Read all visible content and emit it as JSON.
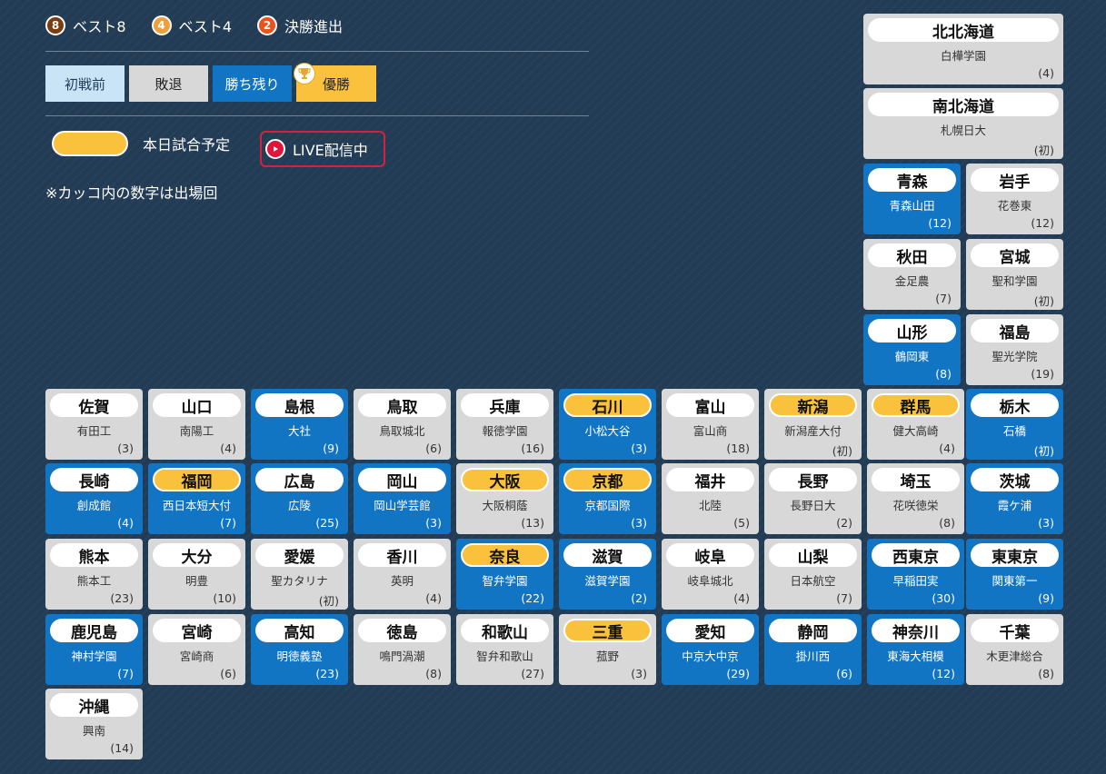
{
  "legend": [
    {
      "num": "8",
      "label": "ベスト8",
      "color": "#7a3d10"
    },
    {
      "num": "4",
      "label": "ベスト4",
      "color": "#ef9f3a"
    },
    {
      "num": "2",
      "label": "決勝進出",
      "color": "#e8541b"
    }
  ],
  "status": {
    "before": "初戦前",
    "lost": "敗退",
    "remaining": "勝ち残り",
    "champion": "優勝"
  },
  "today_label": "本日試合予定",
  "live_label": "LIVE配信中",
  "note": "※カッコ内の数字は出場回",
  "colors": {
    "remaining": "#1275c4",
    "lost": "#d8d8d8",
    "before": "#c9e4f6",
    "champion": "#f9c13c",
    "today": "#f9c13c",
    "live": "#e0143c",
    "background": "#233c55"
  },
  "prefectures": [
    {
      "pref": "北北海道",
      "school": "白樺学園",
      "count": "(4)",
      "state": "gray",
      "today": false
    },
    {
      "pref": "南北海道",
      "school": "札幌日大",
      "count": "(初)",
      "state": "gray",
      "today": false
    },
    {
      "pref": "青森",
      "school": "青森山田",
      "count": "(12)",
      "state": "blue",
      "today": false
    },
    {
      "pref": "岩手",
      "school": "花巻東",
      "count": "(12)",
      "state": "gray",
      "today": false
    },
    {
      "pref": "秋田",
      "school": "金足農",
      "count": "(7)",
      "state": "gray",
      "today": false
    },
    {
      "pref": "宮城",
      "school": "聖和学園",
      "count": "(初)",
      "state": "gray",
      "today": false
    },
    {
      "pref": "山形",
      "school": "鶴岡東",
      "count": "(8)",
      "state": "blue",
      "today": false
    },
    {
      "pref": "福島",
      "school": "聖光学院",
      "count": "(19)",
      "state": "gray",
      "today": false
    },
    {
      "pref": "佐賀",
      "school": "有田工",
      "count": "(3)",
      "state": "gray",
      "today": false
    },
    {
      "pref": "山口",
      "school": "南陽工",
      "count": "(4)",
      "state": "gray",
      "today": false
    },
    {
      "pref": "島根",
      "school": "大社",
      "count": "(9)",
      "state": "blue",
      "today": false
    },
    {
      "pref": "鳥取",
      "school": "鳥取城北",
      "count": "(6)",
      "state": "gray",
      "today": false
    },
    {
      "pref": "兵庫",
      "school": "報徳学園",
      "count": "(16)",
      "state": "gray",
      "today": false
    },
    {
      "pref": "石川",
      "school": "小松大谷",
      "count": "(3)",
      "state": "blue",
      "today": true
    },
    {
      "pref": "富山",
      "school": "富山商",
      "count": "(18)",
      "state": "gray",
      "today": false
    },
    {
      "pref": "新潟",
      "school": "新潟産大付",
      "count": "(初)",
      "state": "gray",
      "today": true
    },
    {
      "pref": "群馬",
      "school": "健大高崎",
      "count": "(4)",
      "state": "gray",
      "today": true
    },
    {
      "pref": "栃木",
      "school": "石橋",
      "count": "(初)",
      "state": "blue",
      "today": false
    },
    {
      "pref": "長崎",
      "school": "創成館",
      "count": "(4)",
      "state": "blue",
      "today": false
    },
    {
      "pref": "福岡",
      "school": "西日本短大付",
      "count": "(7)",
      "state": "blue",
      "today": true
    },
    {
      "pref": "広島",
      "school": "広陵",
      "count": "(25)",
      "state": "blue",
      "today": false
    },
    {
      "pref": "岡山",
      "school": "岡山学芸館",
      "count": "(3)",
      "state": "blue",
      "today": false
    },
    {
      "pref": "大阪",
      "school": "大阪桐蔭",
      "count": "(13)",
      "state": "gray",
      "today": true
    },
    {
      "pref": "京都",
      "school": "京都国際",
      "count": "(3)",
      "state": "blue",
      "today": true
    },
    {
      "pref": "福井",
      "school": "北陸",
      "count": "(5)",
      "state": "gray",
      "today": false
    },
    {
      "pref": "長野",
      "school": "長野日大",
      "count": "(2)",
      "state": "gray",
      "today": false
    },
    {
      "pref": "埼玉",
      "school": "花咲徳栄",
      "count": "(8)",
      "state": "gray",
      "today": false
    },
    {
      "pref": "茨城",
      "school": "霞ケ浦",
      "count": "(3)",
      "state": "blue",
      "today": false
    },
    {
      "pref": "熊本",
      "school": "熊本工",
      "count": "(23)",
      "state": "gray",
      "today": false
    },
    {
      "pref": "大分",
      "school": "明豊",
      "count": "(10)",
      "state": "gray",
      "today": false
    },
    {
      "pref": "愛媛",
      "school": "聖カタリナ",
      "count": "(初)",
      "state": "gray",
      "today": false
    },
    {
      "pref": "香川",
      "school": "英明",
      "count": "(4)",
      "state": "gray",
      "today": false
    },
    {
      "pref": "奈良",
      "school": "智弁学園",
      "count": "(22)",
      "state": "blue",
      "today": true
    },
    {
      "pref": "滋賀",
      "school": "滋賀学園",
      "count": "(2)",
      "state": "blue",
      "today": false
    },
    {
      "pref": "岐阜",
      "school": "岐阜城北",
      "count": "(4)",
      "state": "gray",
      "today": false
    },
    {
      "pref": "山梨",
      "school": "日本航空",
      "count": "(7)",
      "state": "gray",
      "today": false
    },
    {
      "pref": "西東京",
      "school": "早稲田実",
      "count": "(30)",
      "state": "blue",
      "today": false
    },
    {
      "pref": "東東京",
      "school": "関東第一",
      "count": "(9)",
      "state": "blue",
      "today": false
    },
    {
      "pref": "鹿児島",
      "school": "神村学園",
      "count": "(7)",
      "state": "blue",
      "today": false
    },
    {
      "pref": "宮崎",
      "school": "宮崎商",
      "count": "(6)",
      "state": "gray",
      "today": false
    },
    {
      "pref": "高知",
      "school": "明徳義塾",
      "count": "(23)",
      "state": "blue",
      "today": false
    },
    {
      "pref": "徳島",
      "school": "鳴門渦潮",
      "count": "(8)",
      "state": "gray",
      "today": false
    },
    {
      "pref": "和歌山",
      "school": "智弁和歌山",
      "count": "(27)",
      "state": "gray",
      "today": false
    },
    {
      "pref": "三重",
      "school": "菰野",
      "count": "(3)",
      "state": "gray",
      "today": true
    },
    {
      "pref": "愛知",
      "school": "中京大中京",
      "count": "(29)",
      "state": "blue",
      "today": false
    },
    {
      "pref": "静岡",
      "school": "掛川西",
      "count": "(6)",
      "state": "blue",
      "today": false
    },
    {
      "pref": "神奈川",
      "school": "東海大相模",
      "count": "(12)",
      "state": "blue",
      "today": false
    },
    {
      "pref": "千葉",
      "school": "木更津総合",
      "count": "(8)",
      "state": "gray",
      "today": false
    },
    {
      "pref": "沖縄",
      "school": "興南",
      "count": "(14)",
      "state": "gray",
      "today": false
    }
  ]
}
